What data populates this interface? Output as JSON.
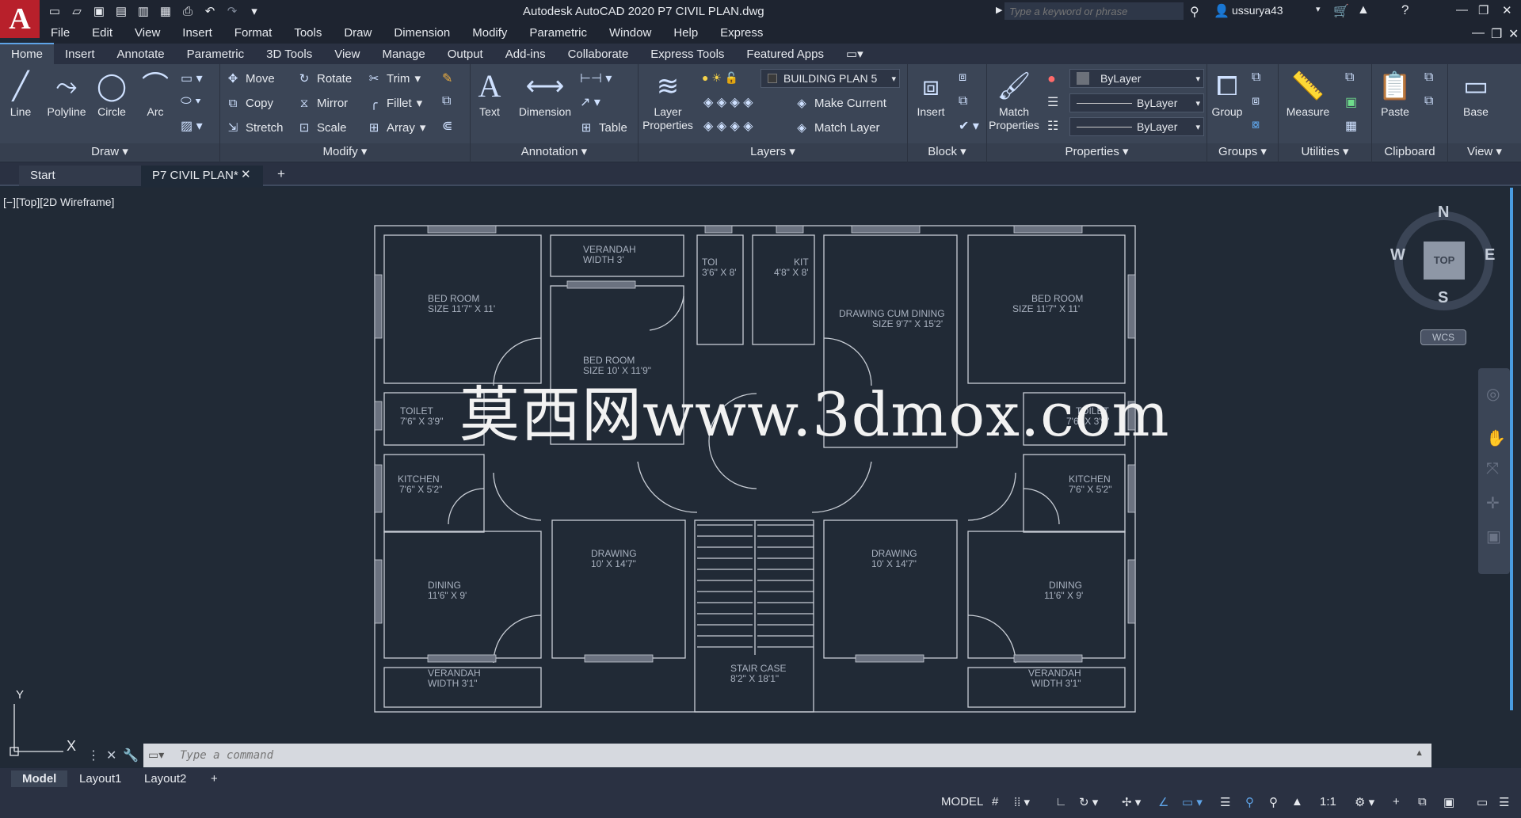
{
  "app": {
    "title": "Autodesk AutoCAD 2020    P7 CIVIL PLAN.dwg",
    "search_placeholder": "Type a keyword or phrase",
    "user": "ussurya43"
  },
  "menu": [
    "File",
    "Edit",
    "View",
    "Insert",
    "Format",
    "Tools",
    "Draw",
    "Dimension",
    "Modify",
    "Parametric",
    "Window",
    "Help",
    "Express"
  ],
  "ribbon_tabs": [
    "Home",
    "Insert",
    "Annotate",
    "Parametric",
    "3D Tools",
    "View",
    "Manage",
    "Output",
    "Add-ins",
    "Collaborate",
    "Express Tools",
    "Featured Apps"
  ],
  "ribbon": {
    "draw": {
      "title": "Draw",
      "line": "Line",
      "polyline": "Polyline",
      "circle": "Circle",
      "arc": "Arc"
    },
    "modify": {
      "title": "Modify",
      "move": "Move",
      "rotate": "Rotate",
      "trim": "Trim",
      "copy": "Copy",
      "mirror": "Mirror",
      "fillet": "Fillet",
      "stretch": "Stretch",
      "scale": "Scale",
      "array": "Array"
    },
    "annotation": {
      "title": "Annotation",
      "text": "Text",
      "dimension": "Dimension",
      "table": "Table"
    },
    "layers": {
      "title": "Layers",
      "layer_properties": "Layer Properties",
      "current_layer": "BUILDING PLAN 5",
      "make_current": "Make Current",
      "match_layer": "Match Layer"
    },
    "block": {
      "title": "Block",
      "insert": "Insert"
    },
    "properties": {
      "title": "Properties",
      "match": "Match Properties",
      "color": "ByLayer",
      "linetype": "ByLayer",
      "lineweight": "ByLayer"
    },
    "groups": {
      "title": "Groups",
      "group": "Group"
    },
    "utilities": {
      "title": "Utilities",
      "measure": "Measure"
    },
    "clipboard": {
      "title": "Clipboard",
      "paste": "Paste"
    },
    "view": {
      "title": "View",
      "base": "Base"
    }
  },
  "doc_tabs": [
    "Start",
    "P7 CIVIL PLAN*"
  ],
  "viewport_label": "[−][Top][2D Wireframe]",
  "viewcube": {
    "top": "TOP",
    "n": "N",
    "s": "S",
    "e": "E",
    "w": "W",
    "wcs": "WCS"
  },
  "ucs": {
    "x": "X",
    "y": "Y"
  },
  "watermark": "莫西网www.3dmox.com",
  "plan_labels": {
    "bed_left": [
      "BED ROOM",
      "SIZE 11'7\" X 11'"
    ],
    "verandah_top": [
      "VERANDAH",
      "WIDTH 3'"
    ],
    "bed_mid": [
      "BED ROOM",
      "SIZE 10' X 11'9\""
    ],
    "toi": [
      "TOI",
      "3'6\" X 8'"
    ],
    "kit": [
      "KIT",
      "4'8\" X 8'"
    ],
    "drawing_dining": [
      "DRAWING CUM DINING",
      "SIZE 9'7\" X 15'2'"
    ],
    "bed_right": [
      "BED ROOM",
      "SIZE 11'7\" X 11'"
    ],
    "toilet_left": [
      "TOILET",
      "7'6\" X 3'9\""
    ],
    "toilet_right": [
      "TOILET",
      "7'6\" X 3'9\""
    ],
    "kitchen_left": [
      "KITCHEN",
      "7'6\" X 5'2\""
    ],
    "kitchen_right": [
      "KITCHEN",
      "7'6\" X 5'2\""
    ],
    "drawing_left": [
      "DRAWING",
      "10' X 14'7\""
    ],
    "drawing_right": [
      "DRAWING",
      "10' X 14'7\""
    ],
    "dining_left": [
      "DINING",
      "11'6\" X 9'"
    ],
    "dining_right": [
      "DINING",
      "11'6\" X 9'"
    ],
    "verandah_bl": [
      "VERANDAH",
      "WIDTH 3'1\""
    ],
    "verandah_br": [
      "VERANDAH",
      "WIDTH 3'1\""
    ],
    "stair": [
      "STAIR CASE",
      "8'2\" X 18'1\""
    ]
  },
  "command": {
    "placeholder": "Type a command"
  },
  "layout_tabs": [
    "Model",
    "Layout1",
    "Layout2"
  ],
  "status": {
    "model": "MODEL",
    "scale": "1:1"
  }
}
